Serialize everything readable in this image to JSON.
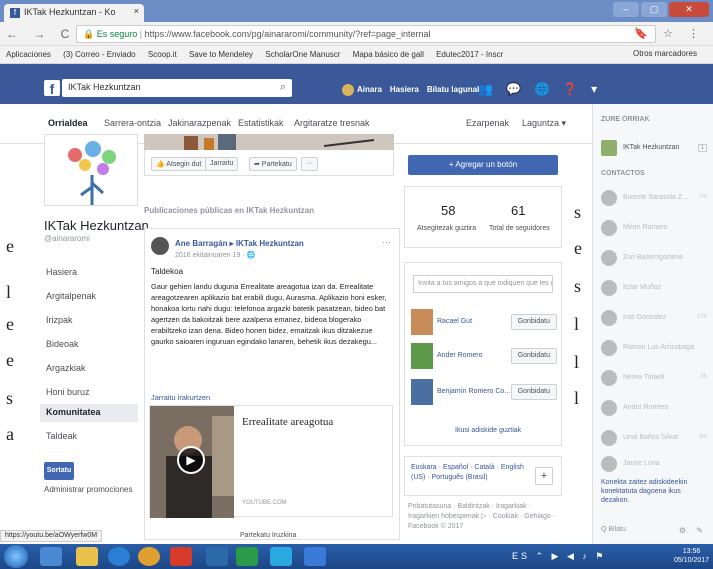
{
  "browser": {
    "tab_title": "IKTak Hezkuntzan - Ko",
    "tab_close": "×",
    "window_buttons": [
      "–",
      "▢",
      "✕"
    ],
    "nav_glyphs": "← → C ⌂",
    "secure_label": "Es seguro",
    "url": "https://www.facebook.com/pg/ainararomi/community/?ref=page_internal",
    "addr_icons": "🔖 ☆ ⋮",
    "bookmarks": [
      "Aplicaciones",
      "(3) Correo - Enviado",
      "Scoop.it",
      "Save to Mendeley",
      "ScholarOne Manuscr",
      "Mapa básico de gall",
      "Edutec2017 - Inscr"
    ],
    "other_bookmarks": "Otros marcadores",
    "status_url": "https://youtu.be/aOWyerfw0M"
  },
  "facebook": {
    "logo": "f",
    "search_value": "IKTak Hezkuntzan",
    "user": [
      "Ainara",
      "Hasiera",
      "Bilatu lagunak"
    ],
    "top_icons": "👥 💬 🌐 ❓ ▾",
    "page_nav": [
      "Orrialdea",
      "Sarrera-ontzia",
      "Jakinarazpenak",
      "Estatistikak",
      "Argitaratze tresnak"
    ],
    "page_nav_right": [
      "Ezarpenak",
      "Laguntza ▾"
    ]
  },
  "left": {
    "page_name": "IKTak Hezkuntzan",
    "handle": "@ainararomi",
    "nav": [
      "Hasiera",
      "Argitalpenak",
      "Irizpak",
      "Bideoak",
      "Argazkiak",
      "Honi buruz",
      "Komunitatea",
      "Taldeak"
    ],
    "active_nav": "Komunitatea",
    "create_btn": "Sortatu",
    "promos": "Administrar promociones"
  },
  "center": {
    "like_buttons": [
      "👍 Atsegin dut",
      "Jarraitu",
      "➦ Partekatu",
      "···"
    ],
    "public_posts": "Publicaciones públicas en IKTak Hezkuntzan",
    "post": {
      "author": "Ane Barragán ▸ IKTak Hezkuntzan",
      "date": "2016 ekitainuaren 19 · 🌐",
      "more": "···",
      "title": "Taldekoa",
      "body": "Gaur gehien landu duguna Errealitate areagotua izan da. Errealitate areagotzearen aplikazio bat erabili dugu, Aurasma. Aplikazio honi esker, honakoa lortu nahi dugu: telefonoa argazki batetik pasatzean, bideo bat agertzen da bakoitzak bere azalpena emanez, bideoa blogerako erabiltzeko izan dena. Bideo honen bidez, emaitzak ikus ditzakezue gaurko saioaren inguruan egindako lanaren, behetik ikus dezakegu...",
      "link_text": "Jarraitu irakurtzen",
      "card_title": "Errealitate areagotua",
      "card_domain": "YOUTUBE.COM",
      "play": "▶",
      "actions": "Partekatu   Iruzkina"
    }
  },
  "right": {
    "add_button": "+ Agregar un botón",
    "stats": [
      {
        "value": "58",
        "label": "Atsegitezak guztira"
      },
      {
        "value": "61",
        "label": "Total de seguidores"
      }
    ],
    "invite_placeholder": "Invita a tus amigos a que indiquen que les gust...",
    "friends": [
      {
        "name": "Racael Gut",
        "button": "Gonbidatu"
      },
      {
        "name": "Ander Romero",
        "button": "Gonbidatu"
      },
      {
        "name": "Benjamín Romero Co...",
        "button": "Gonbidatu"
      }
    ],
    "see_all": "Ikusi adiskide guztiak",
    "languages": "Euskara · Español · Català · English (US) · Português (Brasil)",
    "lang_plus": "+",
    "footer": "Pribatutasuna · Baldintzak · Iragarkiak · Iragarkien hobespenak ▷ · Cookiak · Gehiago · Facebook © 2017"
  },
  "chat": {
    "header_pages": "ZURE ORRIAK",
    "page_item": "IKTak Hezkuntzan",
    "contacts_header": "CONTACTOS",
    "contacts": [
      "Bixente Sarasola Z...",
      "Miren Romero",
      "Zuri Baserrigortena",
      "Itziar Muñoz",
      "Irati Gonzalez",
      "Ramon Lus Arrizabaga",
      "Nerea Tiriaeli",
      "Ander Romero",
      "Unai Baños Silvat",
      "Janire Loria"
    ],
    "times": [
      "7m",
      "",
      "",
      "",
      "10h",
      "",
      "2h",
      "",
      "3m",
      ""
    ],
    "page_time": "1",
    "note": "Konekta zaitez adiskideekin konektatuta dagoena ikus dezakon.",
    "search": "Q Bilatu",
    "icons": "⚙ ✎"
  },
  "overlay_fragments": [
    "s",
    "e",
    "e",
    "e",
    "l",
    "e",
    "s",
    "a",
    "l",
    "l",
    "l",
    "s",
    "a"
  ],
  "taskbar": {
    "tray": "ES ⌃ ▶ ◀ ♪ ⚑",
    "time": "13:56",
    "date": "05/10/2017"
  },
  "colors": {
    "fb_blue": "#3b5998",
    "button_blue": "#4267b2",
    "link_blue": "#365899"
  }
}
